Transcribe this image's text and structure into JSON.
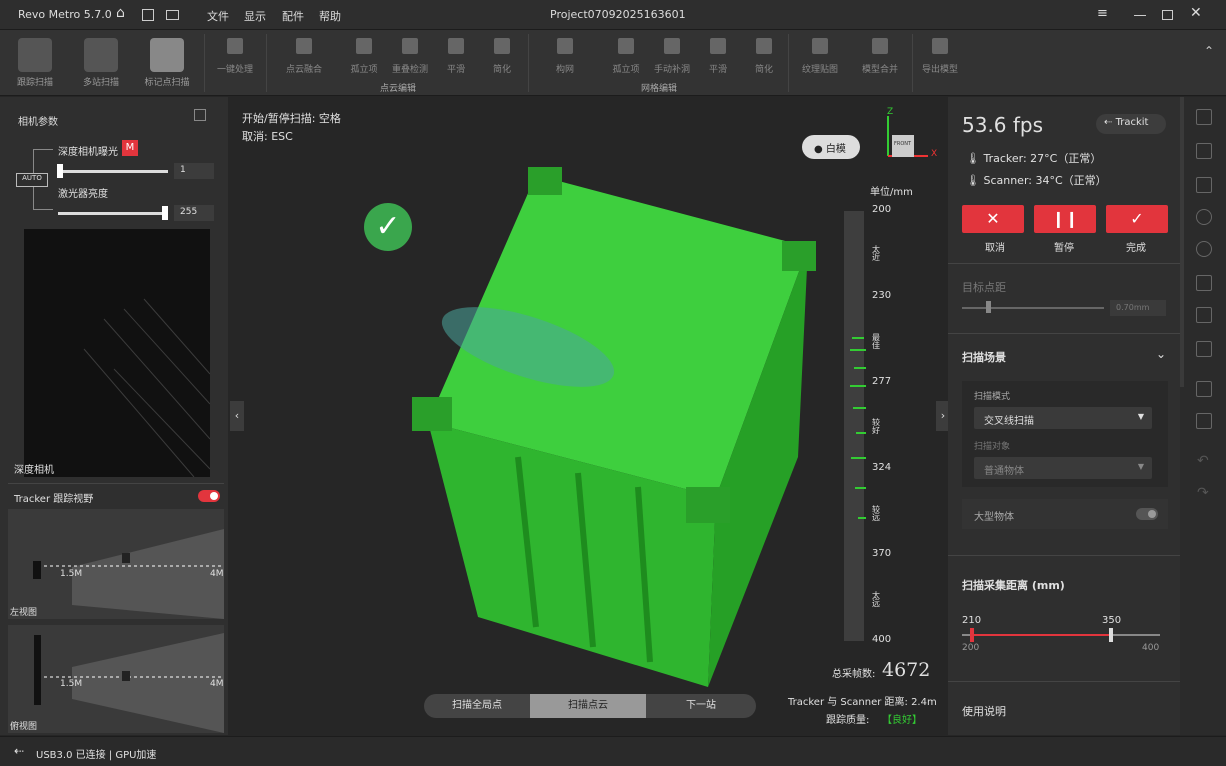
{
  "app": {
    "name": "Revo Metro 5.7.0",
    "menus": [
      "文件",
      "显示",
      "配件",
      "帮助"
    ],
    "project": "Project07092025163601"
  },
  "ribbon": {
    "big": [
      "跟踪扫描",
      "多站扫描",
      "标记点扫描"
    ],
    "onekey": "一键处理",
    "cloud": [
      "点云融合",
      "孤立项",
      "重叠检测",
      "平滑",
      "简化"
    ],
    "cloud_group": "点云编辑",
    "mesh": [
      "构网",
      "孤立项",
      "手动补洞",
      "平滑",
      "简化"
    ],
    "mesh_group": "网格编辑",
    "tex": [
      "纹理贴图",
      "模型合并"
    ],
    "export": "导出模型"
  },
  "left": {
    "cam_title": "相机参数",
    "exposure_label": "深度相机曝光",
    "exposure_badge": "M",
    "exposure_value": "1",
    "laser_label": "激光器亮度",
    "laser_value": "255",
    "depth_cam_label": "深度相机",
    "tracker_title": "Tracker 跟踪视野",
    "dist_near": "1.5M",
    "dist_far": "4M",
    "left_view": "左视图",
    "side_view": "俯视图"
  },
  "viewport": {
    "hint1": "开始/暂停扫描: 空格",
    "hint2": "取消: ESC",
    "white_model": "白模",
    "axes": {
      "z": "Z",
      "x": "X",
      "front": "FRONT"
    },
    "unit": "单位/mm",
    "scale": [
      {
        "v": "200",
        "l": "太近"
      },
      {
        "v": "230",
        "l": "最佳"
      },
      {
        "v": "277",
        "l": "较好"
      },
      {
        "v": "324",
        "l": "较远"
      },
      {
        "v": "370",
        "l": "太远"
      },
      {
        "v": "400",
        "l": ""
      }
    ],
    "frames_label": "总采帧数:",
    "frames_value": "4672",
    "dist_text": "Tracker 与 Scanner 距离: 2.4m",
    "quality_label": "跟踪质量:",
    "quality_value": "【良好】",
    "steps": [
      "扫描全局点",
      "扫描点云",
      "下一站"
    ]
  },
  "right": {
    "fps": "53.6 fps",
    "trackit": "Trackit",
    "tracker_temp": "Tracker: 27°C（正常）",
    "scanner_temp": "Scanner: 34°C（正常）",
    "actions": [
      "取消",
      "暂停",
      "完成"
    ],
    "target_dist_label": "目标点距",
    "target_dist_value": "0.70mm",
    "scene_title": "扫描场景",
    "mode_label": "扫描模式",
    "mode_value": "交叉线扫描",
    "object_label": "扫描对象",
    "object_value": "普通物体",
    "large_label": "大型物体",
    "range_title": "扫描采集距离 (mm)",
    "range_low": "210",
    "range_high": "350",
    "range_min": "200",
    "range_max": "400",
    "range_low_frac": 0.05,
    "range_high_frac": 0.75,
    "help": "使用说明"
  },
  "status": {
    "text": "USB3.0 已连接 | GPU加速"
  },
  "colors": {
    "accent": "#e2353d",
    "scan": "#33cc33",
    "ok": "#3aa64d"
  }
}
